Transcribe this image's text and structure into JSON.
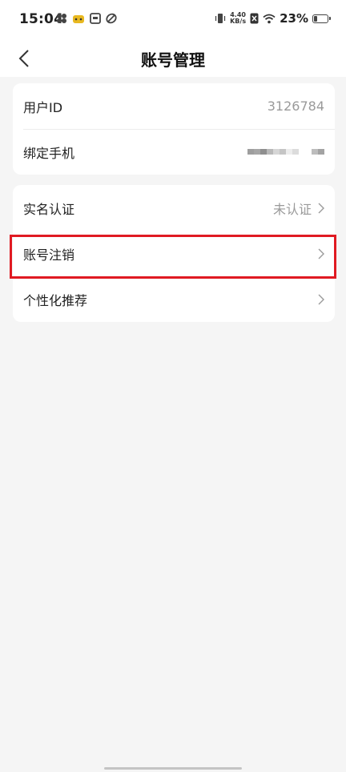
{
  "status_bar": {
    "time": "15:04",
    "net_speed_value": "4.40",
    "net_speed_unit": "KB/s",
    "battery_percent": "23%"
  },
  "header": {
    "title": "账号管理"
  },
  "account_card": {
    "user_id_label": "用户ID",
    "user_id_value": "3126784",
    "phone_label": "绑定手机"
  },
  "settings_card": {
    "real_name_label": "实名认证",
    "real_name_status": "未认证",
    "cancel_account_label": "账号注销",
    "personalization_label": "个性化推荐"
  },
  "colors": {
    "highlight": "#e01a22",
    "background": "#f5f5f5",
    "secondary_text": "#9a9a9a"
  }
}
